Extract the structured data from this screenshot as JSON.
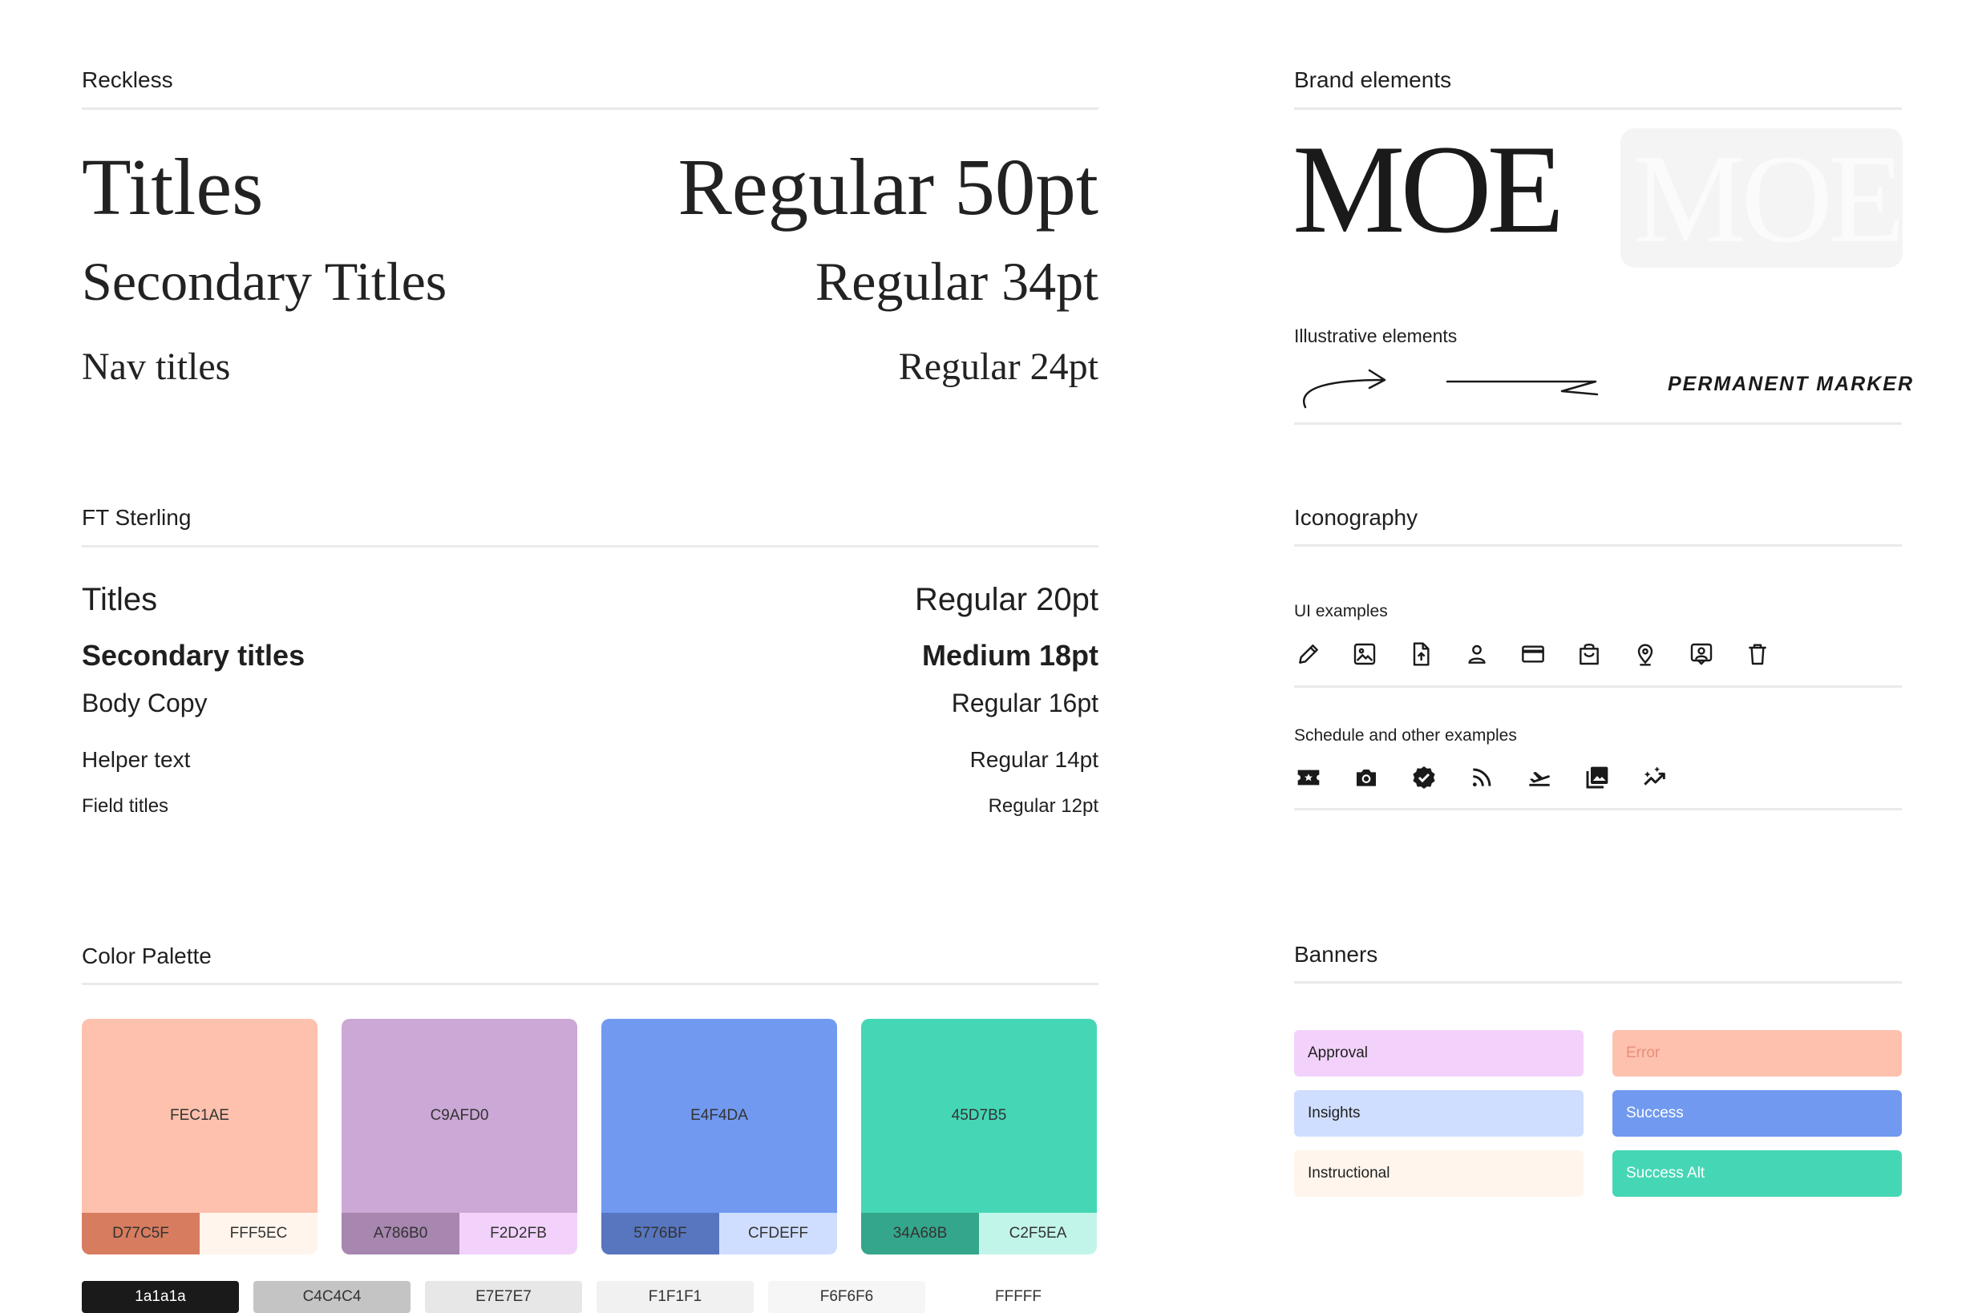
{
  "reckless": {
    "heading": "Reckless",
    "rows": [
      {
        "label": "Titles",
        "spec": "Regular 50pt"
      },
      {
        "label": "Secondary Titles",
        "spec": "Regular 34pt"
      },
      {
        "label": "Nav titles",
        "spec": "Regular 24pt"
      }
    ]
  },
  "sterling": {
    "heading": "FT Sterling",
    "rows": [
      {
        "label": "Titles",
        "spec": "Regular 20pt"
      },
      {
        "label": "Secondary titles",
        "spec": "Medium 18pt"
      },
      {
        "label": "Body Copy",
        "spec": "Regular 16pt"
      },
      {
        "label": "Helper text",
        "spec": "Regular 14pt"
      },
      {
        "label": "Field titles",
        "spec": "Regular 12pt"
      }
    ]
  },
  "palette": {
    "heading": "Color Palette",
    "swatches": [
      {
        "main": "FEC1AE",
        "main_color": "#FEC1AE",
        "left": "D77C5F",
        "left_color": "#D77C5F",
        "right": "FFF5EC",
        "right_color": "#FFF5EC"
      },
      {
        "main": "C9AFD0",
        "main_color": "#CBA8D5",
        "left": "A786B0",
        "left_color": "#A786B0",
        "right": "F2D2FB",
        "right_color": "#F2D2FB"
      },
      {
        "main": "E4F4DA",
        "main_color": "#7199F0",
        "left": "5776BF",
        "left_color": "#5776BF",
        "right": "CFDEFF",
        "right_color": "#CFDEFF"
      },
      {
        "main": "45D7B5",
        "main_color": "#45D7B5",
        "left": "34A68B",
        "left_color": "#34A68B",
        "right": "C2F5EA",
        "right_color": "#C2F5EA"
      }
    ],
    "neutrals": [
      {
        "label": "1a1a1a",
        "color": "#1a1a1a"
      },
      {
        "label": "C4C4C4",
        "color": "#C4C4C4"
      },
      {
        "label": "E7E7E7",
        "color": "#E7E7E7"
      },
      {
        "label": "F1F1F1",
        "color": "#F1F1F1"
      },
      {
        "label": "F6F6F6",
        "color": "#F6F6F6"
      },
      {
        "label": "FFFFF",
        "color": "#FFFFFF"
      }
    ]
  },
  "brand": {
    "heading": "Brand elements",
    "logo_text": "MOE",
    "illustrative_heading": "Illustrative elements",
    "marker_text": "PERMANENT MARKER"
  },
  "iconography": {
    "heading": "Iconography",
    "ui_heading": "UI examples",
    "ui_icons": [
      "pencil-icon",
      "image-icon",
      "file-upload-icon",
      "user-icon",
      "credit-card-icon",
      "shopping-bag-icon",
      "location-pin-icon",
      "user-badge-icon",
      "trash-icon"
    ],
    "schedule_heading": "Schedule and other examples",
    "schedule_icons": [
      "ticket-icon",
      "camera-icon",
      "verified-badge-icon",
      "rss-icon",
      "flight-takeoff-icon",
      "photo-library-icon",
      "trending-icon"
    ]
  },
  "banners": {
    "heading": "Banners",
    "items": [
      {
        "label": "Approval",
        "color": "#F2D2FB",
        "text_color": "#1f1f1f"
      },
      {
        "label": "Error",
        "color": "#FEC1AE",
        "text_color": "#E6907A"
      },
      {
        "label": "Insights",
        "color": "#CFDEFF",
        "text_color": "#1f1f1f"
      },
      {
        "label": "Success",
        "color": "#7199F0",
        "text_color": "#ffffff"
      },
      {
        "label": "Instructional",
        "color": "#FFF5EC",
        "text_color": "#1f1f1f"
      },
      {
        "label": "Success Alt",
        "color": "#45D7B5",
        "text_color": "#ffffff"
      }
    ]
  }
}
